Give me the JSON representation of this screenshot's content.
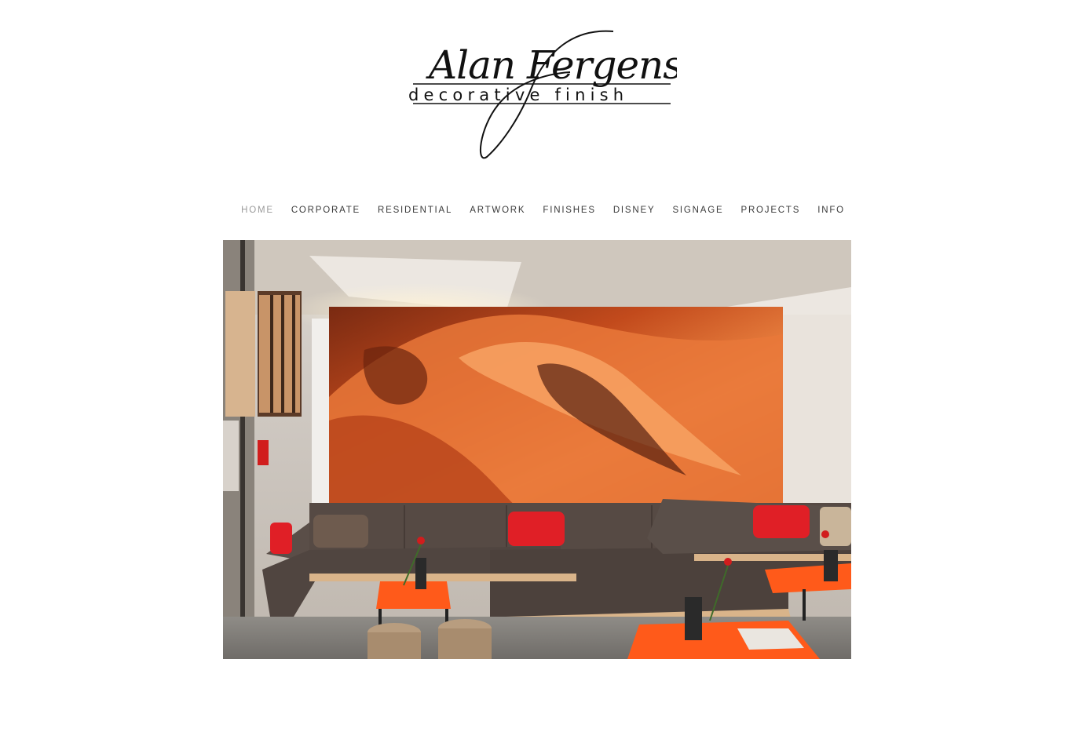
{
  "logo": {
    "name_text": "Alan Fergens",
    "tagline_text": "decorative finish"
  },
  "nav": {
    "items": [
      {
        "label": "HOME",
        "active": true
      },
      {
        "label": "CORPORATE",
        "active": false
      },
      {
        "label": "RESIDENTIAL",
        "active": false
      },
      {
        "label": "ARTWORK",
        "active": false
      },
      {
        "label": "FINISHES",
        "active": false
      },
      {
        "label": "DISNEY",
        "active": false
      },
      {
        "label": "SIGNAGE",
        "active": false
      },
      {
        "label": "PROJECTS",
        "active": false
      },
      {
        "label": "INFO",
        "active": false
      }
    ]
  },
  "hero": {
    "image": "lounge-with-orange-swirl-mural"
  },
  "colors": {
    "nav_text": "#3a3a3a",
    "nav_active": "#9a9a9a",
    "mural_orange": "#e06a2a",
    "table_orange": "#ff5a1a",
    "cushion_red": "#e01f26"
  }
}
